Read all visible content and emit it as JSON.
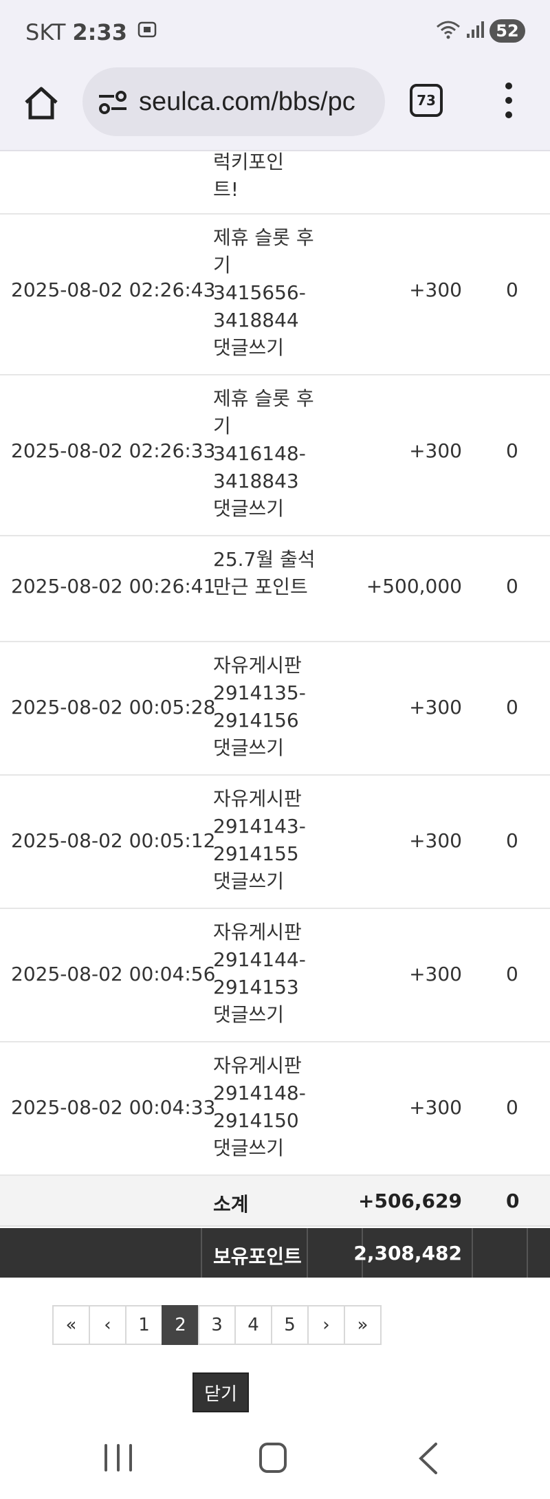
{
  "status_bar": {
    "carrier": "SKT",
    "time": "2:33",
    "battery": "52"
  },
  "browser": {
    "url": "seulca.com/bbs/pc",
    "tab_count": "73"
  },
  "partial_row": {
    "desc": "럭키포인트!"
  },
  "rows": [
    {
      "date": "2025-08-02 02:26:43",
      "desc": "제휴 슬롯 후기 3415656-3418844 댓글쓰기",
      "points": "+300",
      "used": "0"
    },
    {
      "date": "2025-08-02 02:26:33",
      "desc": "제휴 슬롯 후기 3416148-3418843 댓글쓰기",
      "points": "+300",
      "used": "0"
    },
    {
      "date": "2025-08-02 00:26:41",
      "desc": "25.7월 출석 만근 포인트",
      "points": "+500,000",
      "used": "0"
    },
    {
      "date": "2025-08-02 00:05:28",
      "desc": "자유게시판 2914135-2914156 댓글쓰기",
      "points": "+300",
      "used": "0"
    },
    {
      "date": "2025-08-02 00:05:12",
      "desc": "자유게시판 2914143-2914155 댓글쓰기",
      "points": "+300",
      "used": "0"
    },
    {
      "date": "2025-08-02 00:04:56",
      "desc": "자유게시판 2914144-2914153 댓글쓰기",
      "points": "+300",
      "used": "0"
    },
    {
      "date": "2025-08-02 00:04:33",
      "desc": "자유게시판 2914148-2914150 댓글쓰기",
      "points": "+300",
      "used": "0"
    }
  ],
  "subtotal": {
    "label": "소계",
    "points": "+506,629",
    "used": "0"
  },
  "total": {
    "label": "보유포인트",
    "points": "2,308,482"
  },
  "pagination": {
    "first": "«",
    "prev": "‹",
    "next": "›",
    "last": "»",
    "pages": [
      "1",
      "2",
      "3",
      "4",
      "5"
    ],
    "current": "2"
  },
  "close_label": "닫기"
}
